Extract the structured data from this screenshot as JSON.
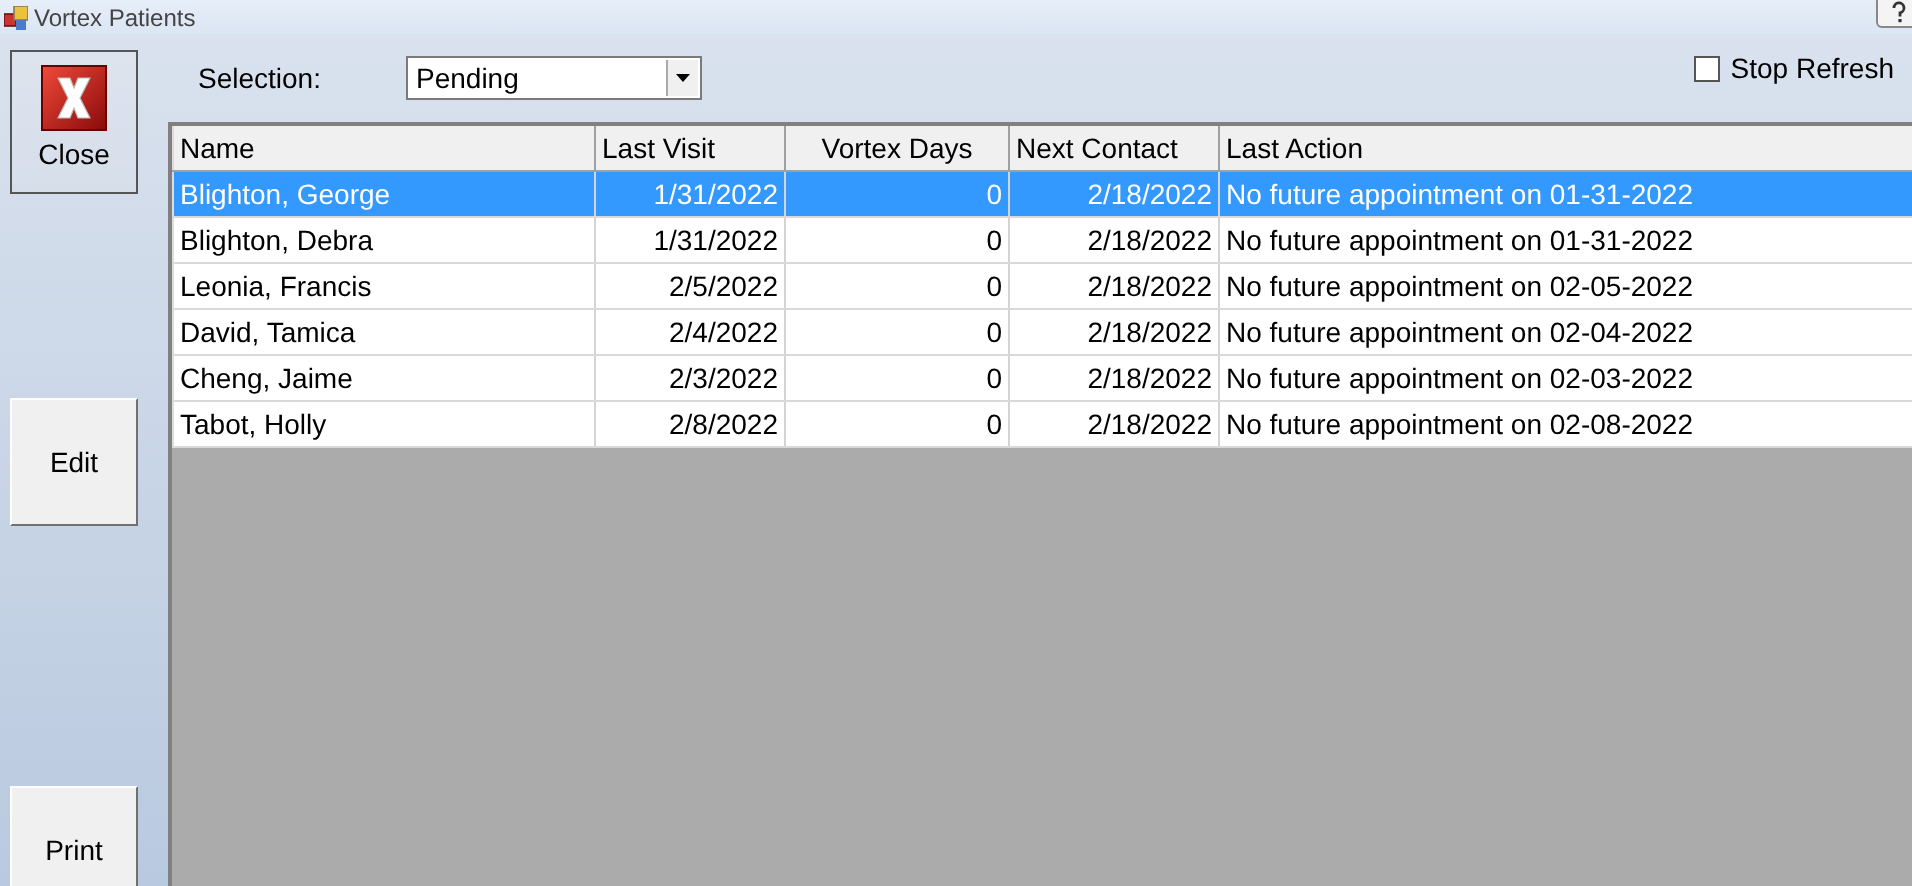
{
  "window": {
    "title": "Vortex Patients"
  },
  "sidebar": {
    "buttons": [
      {
        "kind": "close",
        "label": "Close"
      },
      {
        "kind": "edit",
        "label": "Edit"
      },
      {
        "kind": "print",
        "label": "Print"
      }
    ]
  },
  "filter": {
    "label": "Selection:",
    "value": "Pending"
  },
  "stop_refresh": {
    "label": "Stop Refresh",
    "checked": false
  },
  "table": {
    "columns": [
      {
        "label": "Name",
        "kind": "text"
      },
      {
        "label": "Last Visit",
        "kind": "date"
      },
      {
        "label": "Vortex Days",
        "kind": "number"
      },
      {
        "label": "Next Contact",
        "kind": "date"
      },
      {
        "label": "Last Action",
        "kind": "text"
      }
    ],
    "rows": [
      {
        "selected": true,
        "cells": [
          "Blighton, George",
          "1/31/2022",
          "0",
          "2/18/2022",
          "No future appointment on 01-31-2022"
        ]
      },
      {
        "selected": false,
        "cells": [
          "Blighton, Debra",
          "1/31/2022",
          "0",
          "2/18/2022",
          "No future appointment on 01-31-2022"
        ]
      },
      {
        "selected": false,
        "cells": [
          "Leonia, Francis",
          "2/5/2022",
          "0",
          "2/18/2022",
          "No future appointment on 02-05-2022"
        ]
      },
      {
        "selected": false,
        "cells": [
          "David, Tamica",
          "2/4/2022",
          "0",
          "2/18/2022",
          "No future appointment on 02-04-2022"
        ]
      },
      {
        "selected": false,
        "cells": [
          "Cheng, Jaime",
          "2/3/2022",
          "0",
          "2/18/2022",
          "No future appointment on 02-03-2022"
        ]
      },
      {
        "selected": false,
        "cells": [
          "Tabot, Holly",
          "2/8/2022",
          "0",
          "2/18/2022",
          "No future appointment on 02-08-2022"
        ]
      }
    ]
  }
}
